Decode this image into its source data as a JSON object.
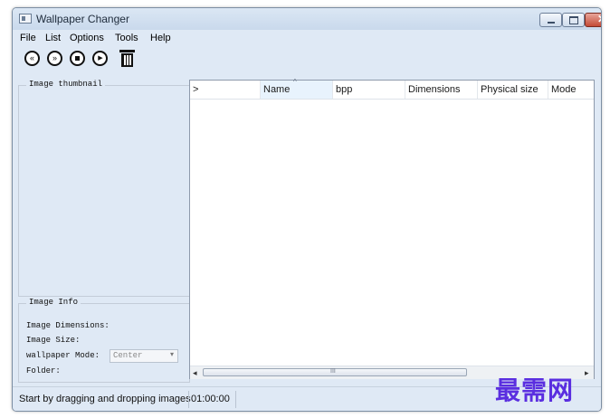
{
  "window": {
    "title": "Wallpaper Changer"
  },
  "menu": [
    "File",
    "List",
    "Options",
    "Tools",
    "Help"
  ],
  "toolbar": {
    "prev_glyph": "«",
    "next_glyph": "»",
    "play_glyph": "▶"
  },
  "thumbnail": {
    "title": "Image thumbnail"
  },
  "info": {
    "title": "Image Info",
    "dimensions_label": "Image Dimensions:",
    "size_label": "Image Size:",
    "mode_label": "wallpaper Mode:",
    "mode_value": "Center",
    "folder_label": "Folder:"
  },
  "list": {
    "columns": [
      ">",
      "Name",
      "bpp",
      "Dimensions",
      "Physical size",
      "Mode"
    ],
    "sort_glyph": "^",
    "scroll_left": "◂",
    "scroll_right": "▸",
    "scroll_grip": "III"
  },
  "status": {
    "message": "Start by dragging and dropping images",
    "time": "01:00:00"
  },
  "watermark": "最需网"
}
